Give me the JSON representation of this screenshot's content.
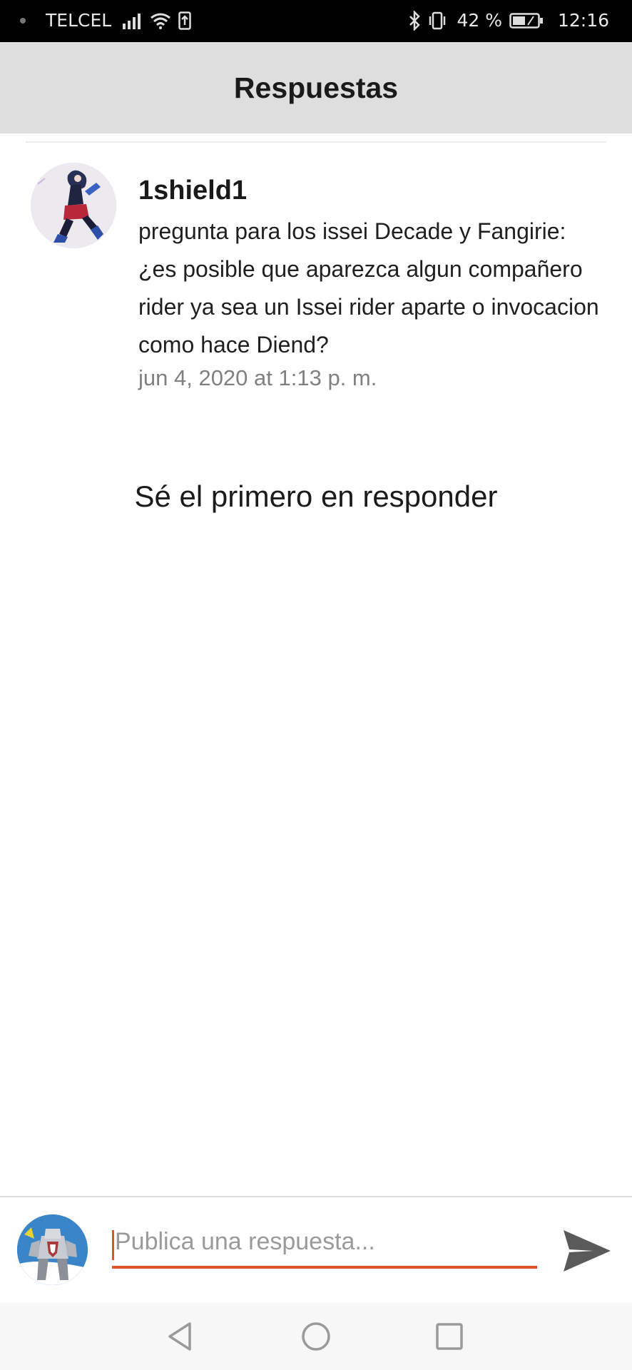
{
  "status_bar": {
    "carrier": "TELCEL",
    "battery_percent": "42 %",
    "time": "12:16",
    "icons": [
      "notification-dot-icon",
      "signal-icon",
      "wifi-icon",
      "upload-icon",
      "bluetooth-icon",
      "vibrate-icon",
      "battery-icon"
    ]
  },
  "header": {
    "title": "Respuestas"
  },
  "question": {
    "username": "1shield1",
    "text": "pregunta para los issei Decade y Fangirie: ¿es posible que aparezca algun compañero rider ya sea un Issei rider aparte o invocacion como hace Diend?",
    "date": "jun 4, 2020 at 1:13 p. m."
  },
  "replies": {
    "empty_message": "Sé el primero en responder"
  },
  "composer": {
    "placeholder": "Publica una respuesta...",
    "value": "",
    "accent_color": "#d9552a"
  },
  "nav_bar": {
    "buttons": [
      "back-icon",
      "home-icon",
      "recents-icon"
    ]
  }
}
